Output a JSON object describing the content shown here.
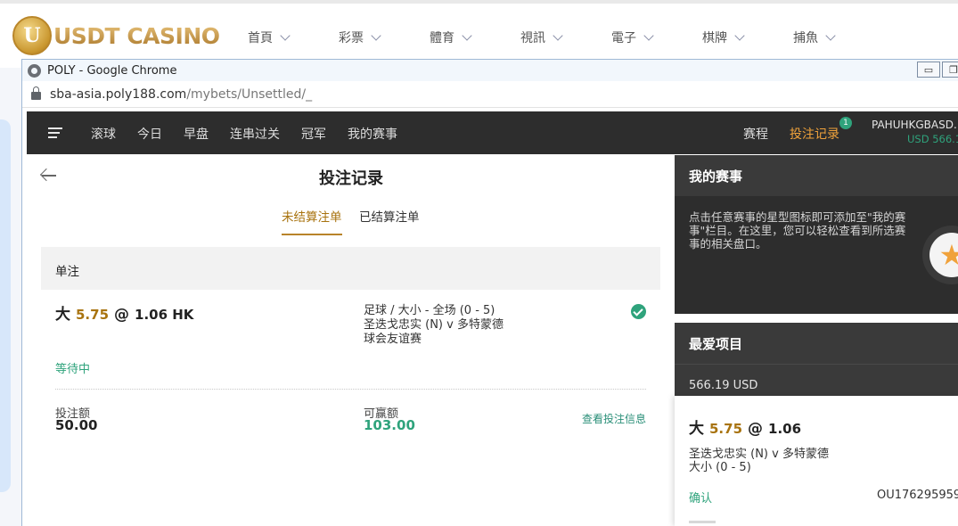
{
  "site": {
    "logo_letter": "U",
    "logo_text": "USDT CASINO",
    "nav": [
      "首頁",
      "彩票",
      "體育",
      "視訊",
      "電子",
      "棋牌",
      "捕魚"
    ]
  },
  "browser": {
    "title": "POLY - Google Chrome",
    "url_host": "sba-asia.poly188.com",
    "url_path": "/mybets/Unsettled/_",
    "minimize": "▭",
    "restore": "❐"
  },
  "sportsbook": {
    "nav": [
      "滚球",
      "今日",
      "早盘",
      "连串过关",
      "冠军",
      "我的赛事"
    ],
    "schedule": "赛程",
    "bet_records": "投注记录",
    "badge": "1",
    "username": "PAHUHKGBASD...",
    "balance": "USD 566.1"
  },
  "records": {
    "title": "投注记录",
    "tab_unsettled": "未结算注单",
    "tab_settled": "已结算注单",
    "section": "单注",
    "bet": {
      "pick": "大",
      "line": "5.75",
      "at": "@",
      "odds": "1.06 HK",
      "market": "足球 / 大小 - 全场 (0 - 5)",
      "match": "圣迭戈忠实 (N) v 多特蒙德",
      "league": "球会友谊赛",
      "status": "等待中",
      "stake_label": "投注额",
      "stake": "50.00",
      "win_label": "可赢额",
      "win": "103.00",
      "detail_link": "查看投注信息"
    }
  },
  "side_panel": {
    "my_events_title": "我的赛事",
    "my_events_text": "点击任意赛事的星型图标即可添加至\"我的赛事\"栏目。在这里，您可以轻松查看到所选赛事的相关盘口。",
    "favorites_title": "最爱项目",
    "favorites_amount": "566.19 USD",
    "card": {
      "pick": "大",
      "line": "5.75",
      "at": "@",
      "odds": "1.06",
      "match": "圣迭戈忠实 (N) v 多特蒙德",
      "market": "大小 (0 - 5)",
      "status": "确认",
      "ticket_id": "OU176295959"
    }
  },
  "colors": {
    "accent_gold": "#a8730f",
    "bet_records_orange": "#f0a23b",
    "success_green": "#2fa37c",
    "dark_bar": "#2d2d2d"
  }
}
